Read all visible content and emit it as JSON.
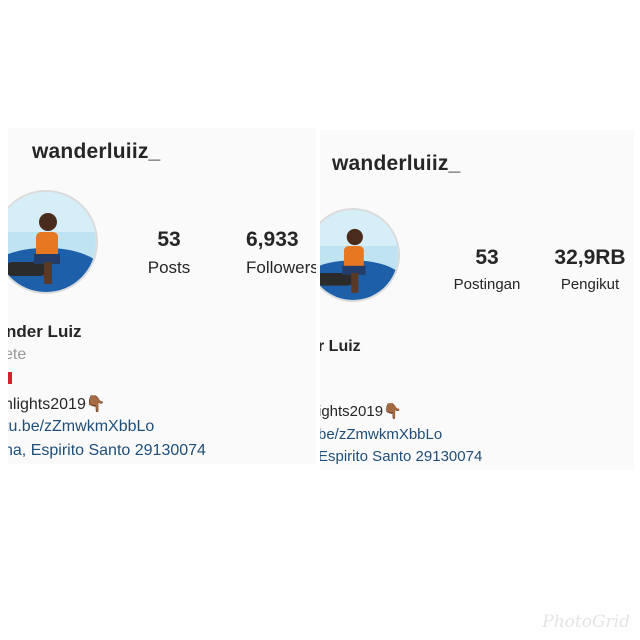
{
  "colors": {
    "text": "#262626",
    "secondary_text": "#999999",
    "link": "#1f4e79",
    "panel_bg": "#fafafa",
    "flag_red": "#d2222d"
  },
  "left_profile": {
    "username": "wanderluiiz_",
    "posts_count": "53",
    "posts_label": "Posts",
    "followers_count": "6,933",
    "followers_label": "Followers",
    "display_name": "nder Luiz",
    "category": "ete",
    "bio_line": "nlights2019",
    "bio_emoji": "👇🏾",
    "link": "tu.be/zZmwkmXbbLo",
    "address": "na, Espirito Santo 29130074"
  },
  "right_profile": {
    "username": "wanderluiiz_",
    "posts_count": "53",
    "posts_label": "Postingan",
    "followers_count": "32,9RB",
    "followers_label": "Pengikut",
    "display_name": "r Luiz",
    "bio_line": "ights2019",
    "bio_emoji": "👇🏾",
    "link": "be/zZmwkmXbbLo",
    "address": " Espirito Santo 29130074"
  },
  "watermark": "PhotoGrid"
}
